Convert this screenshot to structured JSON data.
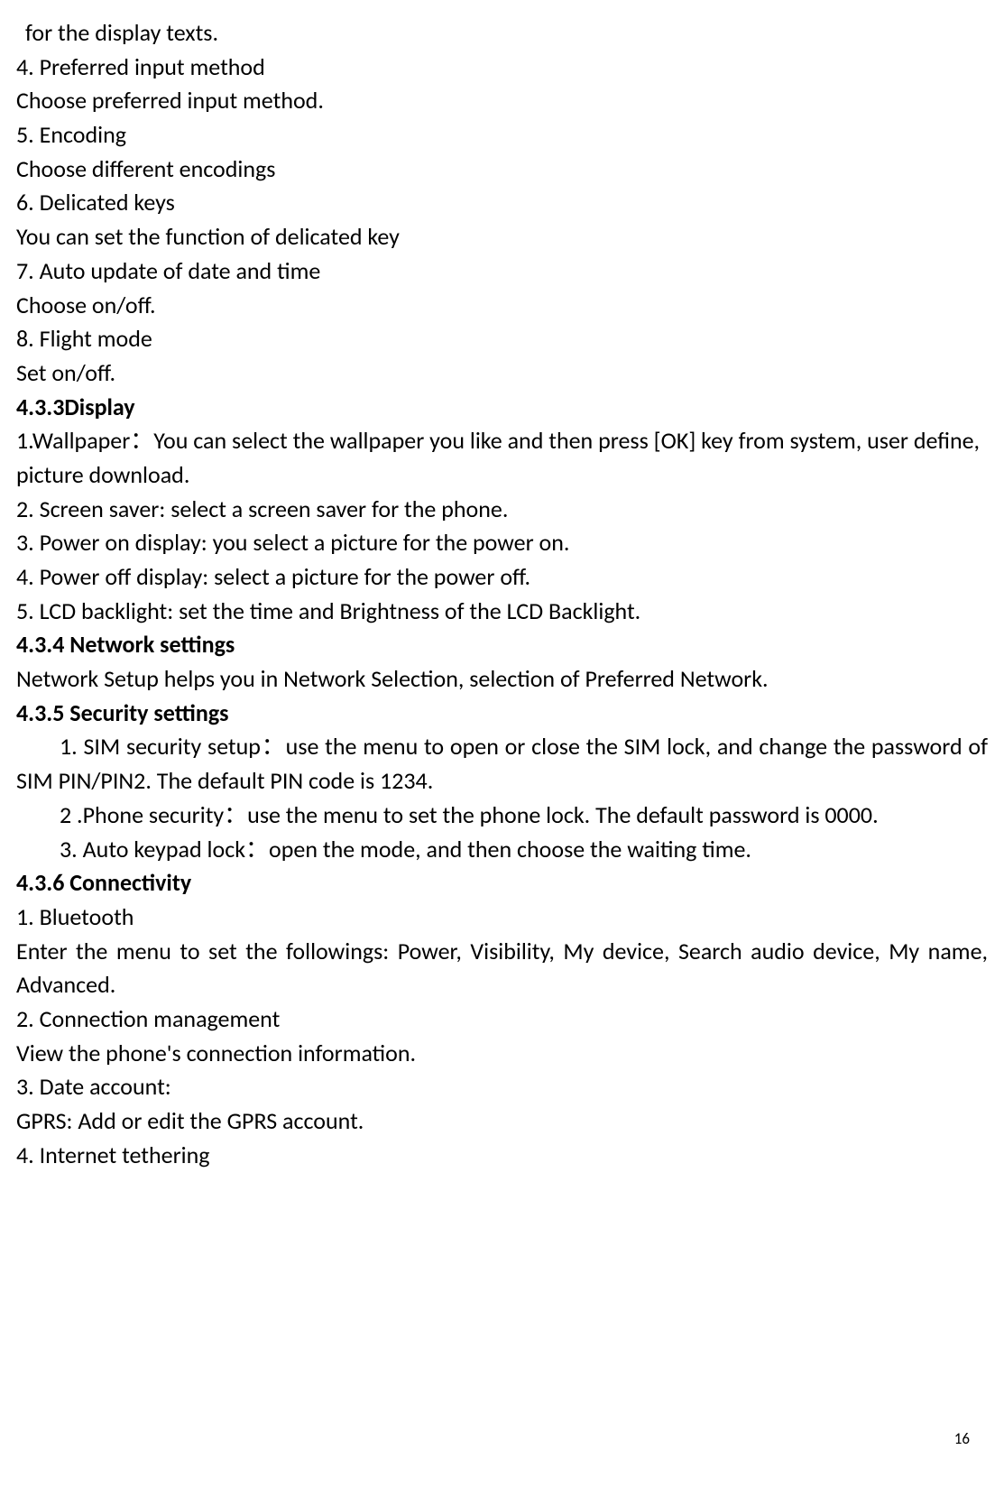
{
  "lines": {
    "l1": "for the display texts.",
    "l2": "4. Preferred input method",
    "l3": "Choose preferred input method.",
    "l4": "5. Encoding",
    "l5": "Choose different encodings",
    "l6": "6. Delicated keys",
    "l7": "You can set the function of delicated key",
    "l8": "7. Auto update of date and time",
    "l9": "Choose on/off.",
    "l10": "8. Flight mode",
    "l11": "Set on/off.",
    "l12": "4.3.3Display",
    "l13": "1.Wallpaper：You can select the wallpaper you like and then press [OK] key from system, user define, picture download.",
    "l14": "2. Screen saver: select a screen saver for the phone.",
    "l15": "3. Power on display: you select a picture for the power on.",
    "l16": "4. Power off display: select a picture for the power off.",
    "l17": "5. LCD backlight: set the time and Brightness of the LCD Backlight.",
    "l18": "4.3.4 Network settings",
    "l19": "Network Setup helps you in Network Selection, selection of Preferred Network.",
    "l20": "4.3.5 Security settings",
    "l21": "1. SIM security setup：use the menu to open or close the SIM lock, and change the password of SIM PIN/PIN2. The default PIN code is 1234.",
    "l22": "2 .Phone security：use the menu to set the phone lock. The default password is 0000.",
    "l23": "3. Auto keypad lock：open the mode, and then choose the waiting time.",
    "l24": "4.3.6 Connectivity",
    "l25": "1. Bluetooth",
    "l26": "Enter the menu to set the followings: Power, Visibility, My device, Search audio device, My name, Advanced.",
    "l27": "2. Connection management",
    "l28": "View the phone's connection information.",
    "l29": "3. Date account:",
    "l30": "GPRS: Add or edit the GPRS account.",
    "l31": "4. Internet tethering"
  },
  "pageNumber": "16"
}
